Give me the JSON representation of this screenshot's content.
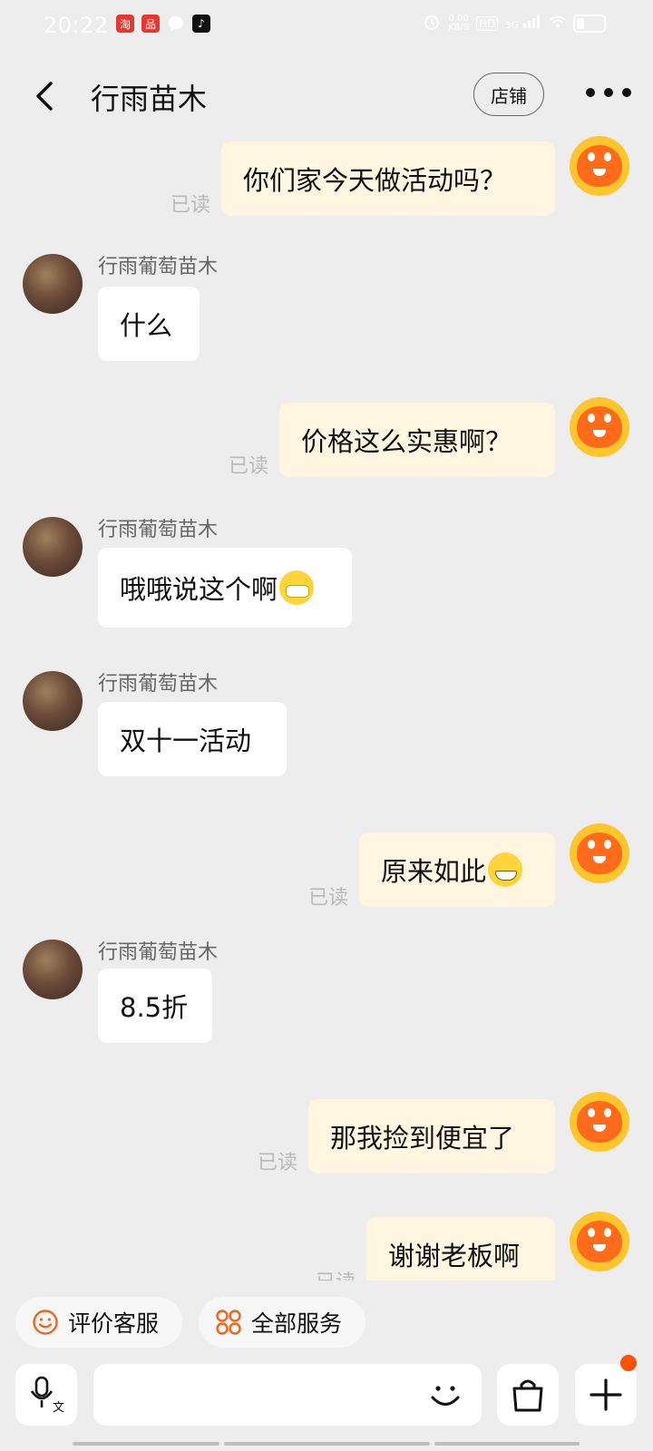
{
  "status_bar": {
    "time": "20:22",
    "net_speed": "0.00",
    "net_unit": "KB/S",
    "signal": "5G",
    "hd": "HD"
  },
  "header": {
    "title": "行雨苗木",
    "shop_label": "店铺"
  },
  "messages": [
    {
      "side": "me",
      "text": "你们家今天做活动吗？",
      "status": "已读"
    },
    {
      "side": "other",
      "sender": "行雨葡萄苗木",
      "text": "什么"
    },
    {
      "side": "me",
      "text": "价格这么实惠啊？",
      "status": "已读"
    },
    {
      "side": "other",
      "sender": "行雨葡萄苗木",
      "text": "哦哦说这个啊",
      "emoji": "sneezing-face"
    },
    {
      "side": "other",
      "sender": "行雨葡萄苗木",
      "text": "双十一活动"
    },
    {
      "side": "me",
      "text": "原来如此",
      "emoji": "grinning-face",
      "status": "已读"
    },
    {
      "side": "other",
      "sender": "行雨葡萄苗木",
      "text": "8.5折"
    },
    {
      "side": "me",
      "text": "那我捡到便宜了",
      "status": "已读"
    },
    {
      "side": "me",
      "text": "谢谢老板啊",
      "status": "已读"
    }
  ],
  "quick_actions": {
    "rate_service": "评价客服",
    "all_services": "全部服务"
  },
  "input": {
    "placeholder": ""
  },
  "colors": {
    "accent": "#FF5000",
    "bubble_me": "#FFF6E2",
    "bubble_other": "#FFFFFF",
    "background": "#EDEDED"
  }
}
